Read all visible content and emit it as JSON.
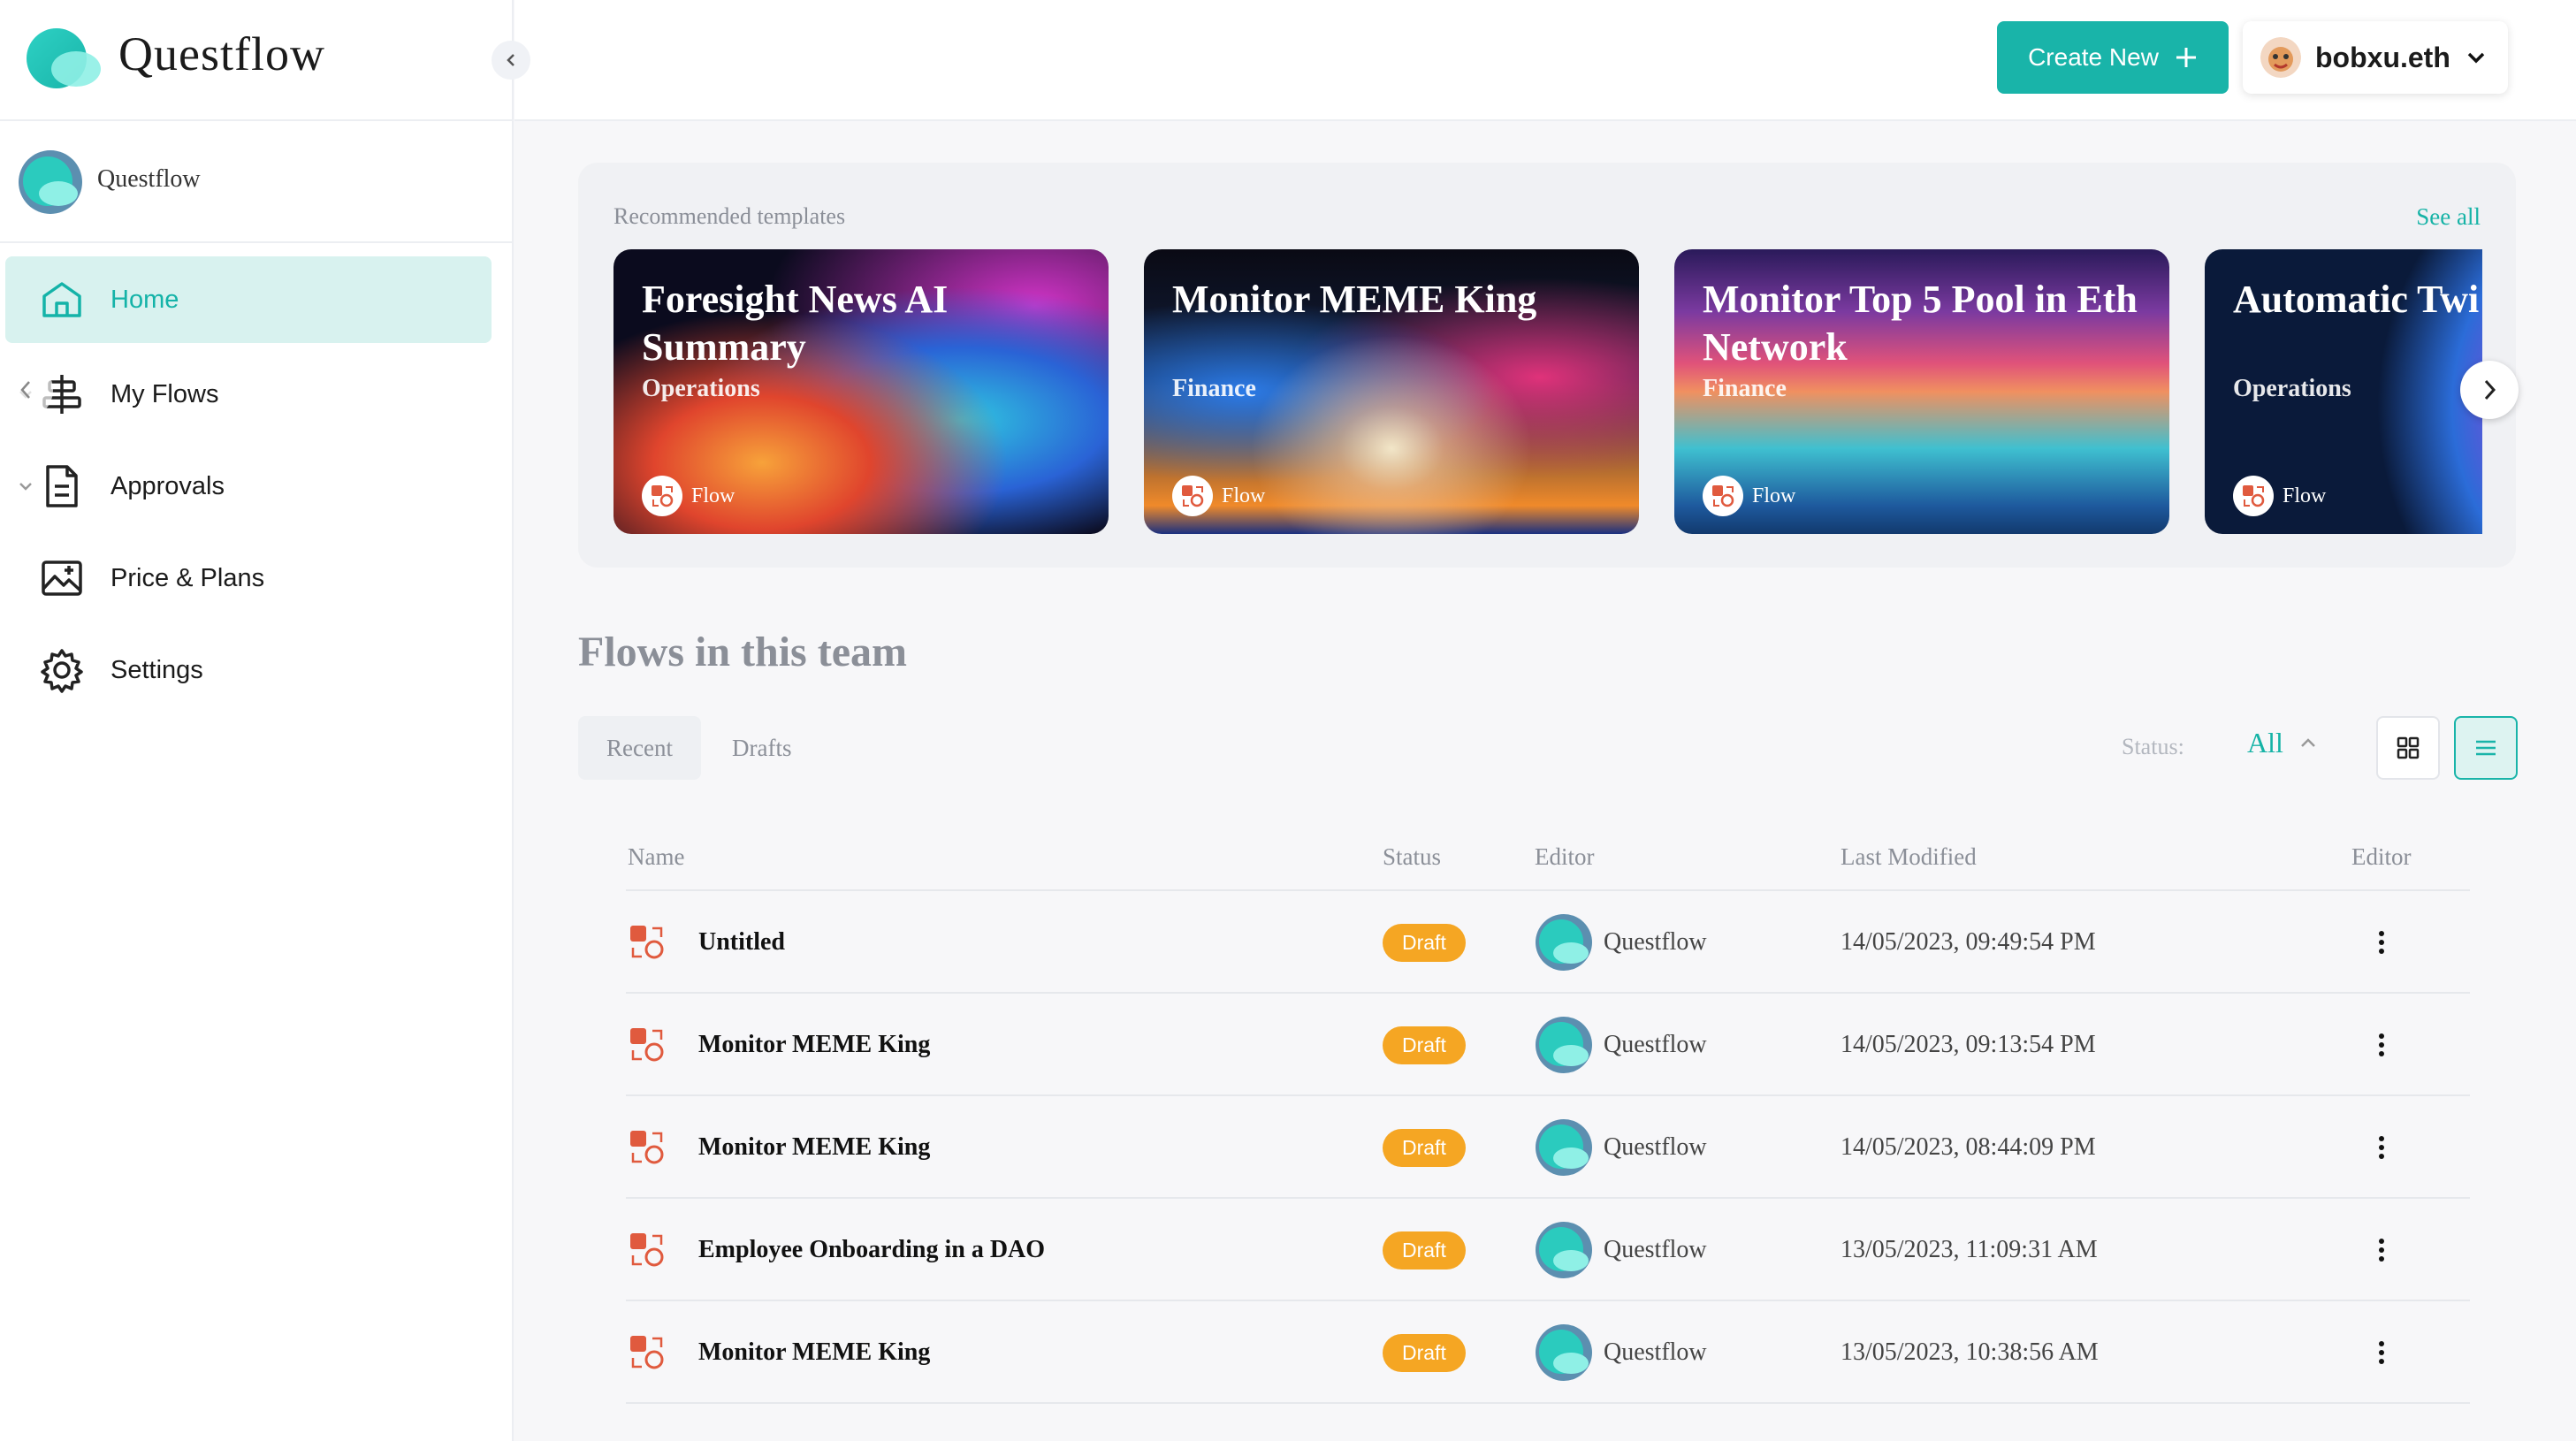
{
  "brand": {
    "name": "Questflow"
  },
  "team": {
    "name": "Questflow"
  },
  "nav": [
    {
      "label": "Home",
      "icon": "home-icon",
      "active": true
    },
    {
      "label": "My Flows",
      "icon": "flows-icon",
      "caret": true
    },
    {
      "label": "Approvals",
      "icon": "document-icon",
      "caret": true
    },
    {
      "label": "Price & Plans",
      "icon": "image-icon"
    },
    {
      "label": "Settings",
      "icon": "gear-icon"
    }
  ],
  "topbar": {
    "create_label": "Create New",
    "user_name": "bobxu.eth"
  },
  "templates": {
    "title": "Recommended templates",
    "see_all": "See all",
    "cards": [
      {
        "title": "Foresight News AI Summary",
        "category": "Operations",
        "type": "Flow"
      },
      {
        "title": "Monitor MEME King",
        "category": "Finance",
        "type": "Flow"
      },
      {
        "title": "Monitor Top 5 Pool in Eth Network",
        "category": "Finance",
        "type": "Flow"
      },
      {
        "title": "Automatic Twi",
        "category": "Operations",
        "type": "Flow"
      }
    ]
  },
  "flows": {
    "title": "Flows in this team",
    "tabs": [
      "Recent",
      "Drafts"
    ],
    "status_label": "Status:",
    "status_value": "All",
    "columns": [
      "Name",
      "Status",
      "Editor",
      "Last Modified",
      "Editor"
    ],
    "rows": [
      {
        "name": "Untitled",
        "status": "Draft",
        "editor": "Questflow",
        "modified": "14/05/2023, 09:49:54 PM"
      },
      {
        "name": "Monitor MEME King",
        "status": "Draft",
        "editor": "Questflow",
        "modified": "14/05/2023, 09:13:54 PM"
      },
      {
        "name": "Monitor MEME King",
        "status": "Draft",
        "editor": "Questflow",
        "modified": "14/05/2023, 08:44:09 PM"
      },
      {
        "name": "Employee Onboarding in a DAO",
        "status": "Draft",
        "editor": "Questflow",
        "modified": "13/05/2023, 11:09:31 AM"
      },
      {
        "name": "Monitor MEME King",
        "status": "Draft",
        "editor": "Questflow",
        "modified": "13/05/2023, 10:38:56 AM"
      }
    ]
  },
  "colors": {
    "accent": "#19b4a9",
    "draft": "#f5a623",
    "flow_icon": "#e05a3e"
  }
}
